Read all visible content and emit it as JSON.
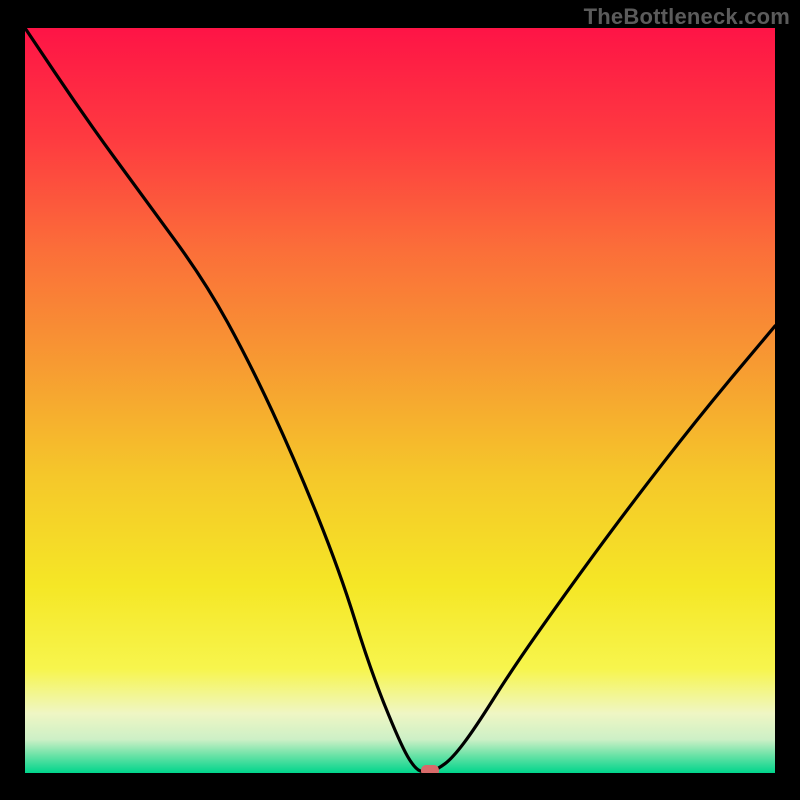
{
  "watermark": "TheBottleneck.com",
  "chart_data": {
    "type": "line",
    "title": "",
    "xlabel": "",
    "ylabel": "",
    "xlim": [
      0,
      100
    ],
    "ylim": [
      0,
      100
    ],
    "grid": false,
    "legend": false,
    "series": [
      {
        "name": "bottleneck-curve",
        "x": [
          0,
          8,
          16,
          24,
          30,
          36,
          42,
          46,
          50,
          52,
          53.5,
          55,
          57,
          60,
          65,
          72,
          80,
          90,
          100
        ],
        "y": [
          100,
          88,
          77,
          66,
          55,
          42,
          27,
          14,
          4,
          0.5,
          0,
          0.5,
          2,
          6,
          14,
          24,
          35,
          48,
          60
        ]
      }
    ],
    "marker": {
      "name": "optimal-point",
      "x": 54,
      "y": 0,
      "color": "#d86a6a"
    },
    "background_gradient": {
      "stops": [
        {
          "offset": 0.0,
          "color": "#fe1446"
        },
        {
          "offset": 0.15,
          "color": "#fe3b40"
        },
        {
          "offset": 0.3,
          "color": "#fb6f39"
        },
        {
          "offset": 0.45,
          "color": "#f79a32"
        },
        {
          "offset": 0.6,
          "color": "#f5c72a"
        },
        {
          "offset": 0.75,
          "color": "#f5e726"
        },
        {
          "offset": 0.86,
          "color": "#f7f54d"
        },
        {
          "offset": 0.92,
          "color": "#eff6c4"
        },
        {
          "offset": 0.955,
          "color": "#cdf0c6"
        },
        {
          "offset": 0.975,
          "color": "#70e3a8"
        },
        {
          "offset": 1.0,
          "color": "#00d58c"
        }
      ]
    }
  }
}
